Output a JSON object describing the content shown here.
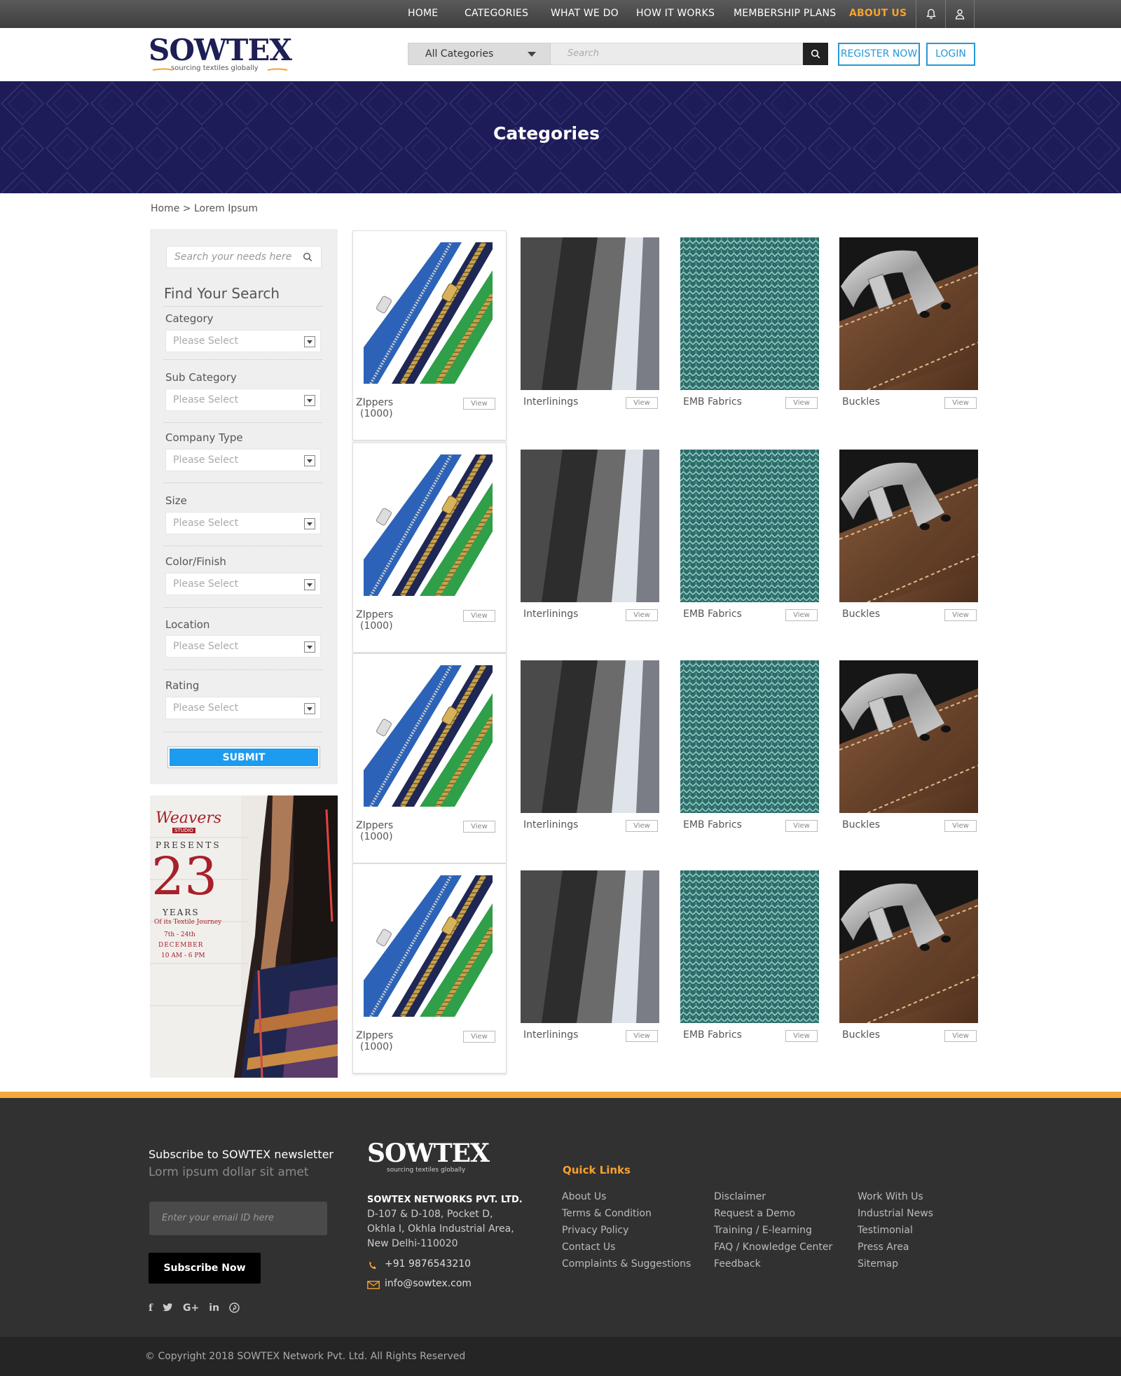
{
  "nav": {
    "items": [
      "HOME",
      "CATEGORIES",
      "WHAT WE DO",
      "HOW IT WORKS",
      "MEMBERSHIP PLANS",
      "ABOUT US"
    ],
    "active": "ABOUT US",
    "icons": [
      "bell-icon",
      "user-icon"
    ]
  },
  "header": {
    "logo_text": "SOWTEX",
    "logo_tagline": "sourcing textiles globally",
    "category_select": "All Categories",
    "search_placeholder": "Search",
    "register_label": "REGISTER NOW",
    "login_label": "LOGIN"
  },
  "banner": {
    "title": "Categories"
  },
  "breadcrumb": "Home > Lorem Ipsum",
  "sidebar": {
    "search_placeholder": "Search your needs here",
    "title": "Find Your Search",
    "filters": [
      {
        "label": "Category",
        "value": "Please Select"
      },
      {
        "label": "Sub Category",
        "value": "Please Select"
      },
      {
        "label": "Company Type",
        "value": "Please Select"
      },
      {
        "label": "Size",
        "value": "Please Select"
      },
      {
        "label": "Color/Finish",
        "value": "Please Select"
      },
      {
        "label": "Location",
        "value": "Please Select"
      },
      {
        "label": "Rating",
        "value": "Please Select"
      }
    ],
    "submit_label": "SUBMIT"
  },
  "ad": {
    "brand": "Weavers",
    "brand_sub": "STUDIO",
    "presents": "PRESENTS",
    "years_number": "23",
    "years": "YEARS",
    "journey": "Of its Textile Journey",
    "dates": "7th - 24th",
    "month": "DECEMBER",
    "time": "10 AM - 6 PM"
  },
  "grid": {
    "view_label": "View",
    "rows": [
      [
        {
          "name": "ZIppers",
          "count": "(1000)",
          "type": "zipper"
        },
        {
          "name": "Interlinings",
          "type": "interlining"
        },
        {
          "name": "EMB Fabrics",
          "type": "emb"
        },
        {
          "name": "Buckles",
          "type": "buckle"
        }
      ],
      [
        {
          "name": "ZIppers",
          "count": "(1000)",
          "type": "zipper"
        },
        {
          "name": "Interlinings",
          "type": "interlining"
        },
        {
          "name": "EMB Fabrics",
          "type": "emb"
        },
        {
          "name": "Buckles",
          "type": "buckle"
        }
      ],
      [
        {
          "name": "ZIppers",
          "count": "(1000)",
          "type": "zipper"
        },
        {
          "name": "Interlinings",
          "type": "interlining"
        },
        {
          "name": "EMB Fabrics",
          "type": "emb"
        },
        {
          "name": "Buckles",
          "type": "buckle"
        }
      ],
      [
        {
          "name": "ZIppers",
          "count": "(1000)",
          "type": "zipper"
        },
        {
          "name": "Interlinings",
          "type": "interlining"
        },
        {
          "name": "EMB Fabrics",
          "type": "emb"
        },
        {
          "name": "Buckles",
          "type": "buckle"
        }
      ]
    ]
  },
  "footer": {
    "newsletter_title": "Subscribe to SOWTEX newsletter",
    "newsletter_sub": "Lorm ipsum dollar sit amet",
    "email_placeholder": "Enter your email ID here",
    "subscribe_label": "Subscribe Now",
    "social": [
      "facebook-icon",
      "twitter-icon",
      "google-plus-icon",
      "linkedin-icon",
      "pinterest-icon"
    ],
    "company": "SOWTEX NETWORKS PVT. LTD.",
    "address": [
      "D-107 & D-108, Pocket D,",
      "Okhla I, Okhla Industrial Area,",
      "New Delhi-110020"
    ],
    "phone": "+91 9876543210",
    "email": "info@sowtex.com",
    "quick_links_title": "Quick Links",
    "links_col1": [
      "About Us",
      "Terms & Condition",
      "Privacy Policy",
      "Contact Us",
      "Complaints & Suggestions"
    ],
    "links_col2": [
      "Disclaimer",
      "Request a Demo",
      "Training / E-learning",
      "FAQ / Knowledge Center",
      "Feedback"
    ],
    "links_col3": [
      "Work With Us",
      "Industrial News",
      "Testimonial",
      "Press Area",
      "Sitemap"
    ],
    "copyright": "© Copyright 2018 SOWTEX Network Pvt. Ltd. All Rights Reserved"
  },
  "colors": {
    "accent": "#f7a22c",
    "brand_navy": "#1d1c58",
    "link_blue": "#2598d8",
    "submit_blue": "#1d9bf0"
  }
}
